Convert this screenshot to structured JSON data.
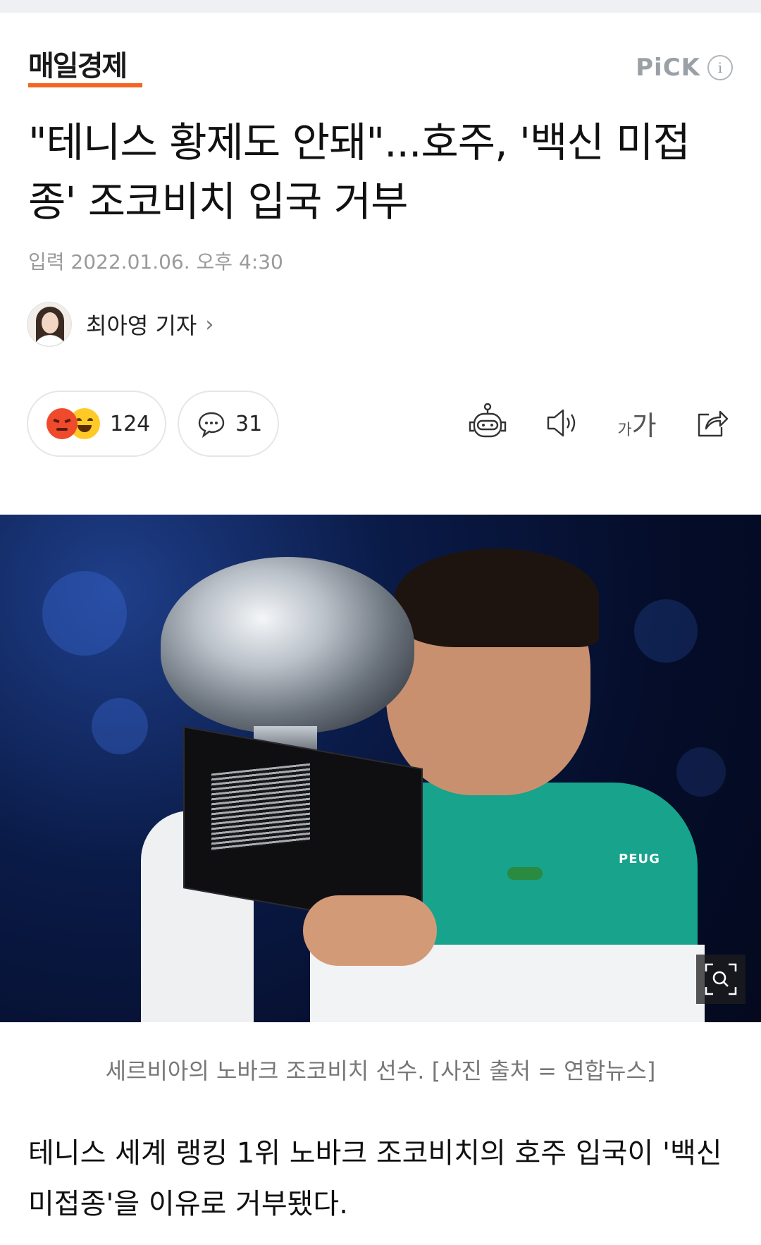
{
  "publisher": {
    "name": "매일경제",
    "accent": "#f26522"
  },
  "pick": {
    "label": "PiCK",
    "info_glyph": "i"
  },
  "article": {
    "headline": "\"테니스 황제도 안돼\"...호주, '백신 미접종' 조코비치 입국 거부",
    "date": "입력 2022.01.06. 오후 4:30",
    "reporter": "최아영 기자",
    "reporter_chevron": "›"
  },
  "reactions": {
    "count": "124",
    "comments": "31"
  },
  "toolbar": {
    "font_small": "가",
    "font_big": "가",
    "icons": [
      "robot-icon",
      "speaker-icon",
      "font-size-icon",
      "share-icon"
    ]
  },
  "photo": {
    "sponsor_text": "PEUG",
    "caption": "세르비아의 노바크 조코비치 선수. [사진 출처 = 연합뉴스]"
  },
  "body": {
    "paragraph1": "테니스 세계 랭킹 1위 노바크 조코비치의 호주 입국이 '백신 미접종'을 이유로 거부됐다."
  }
}
